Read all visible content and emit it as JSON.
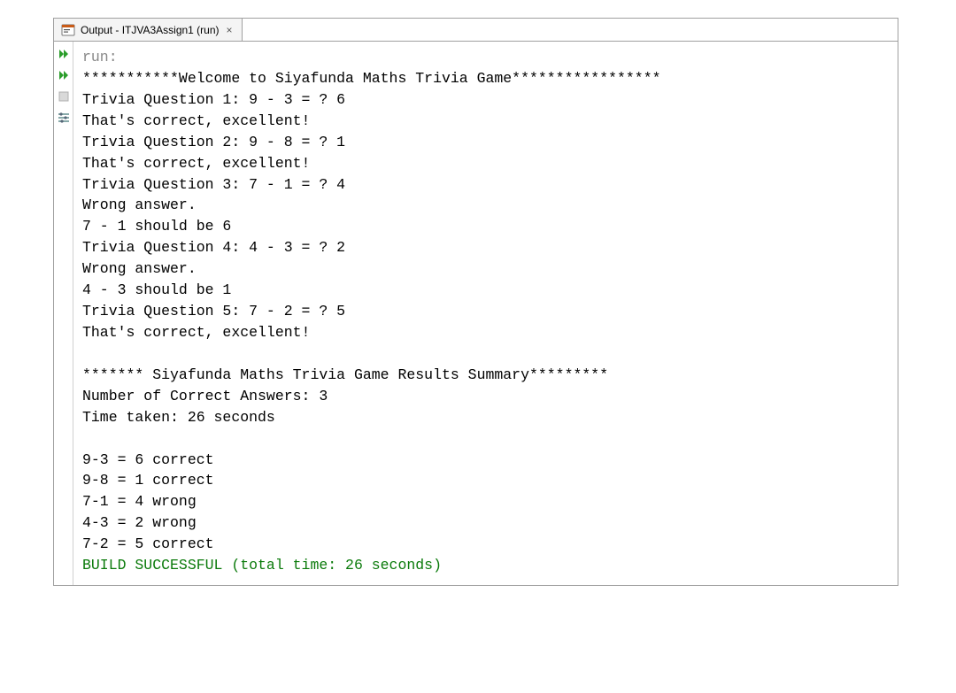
{
  "tab": {
    "title": "Output - ITJVA3Assign1 (run)"
  },
  "output": {
    "run_label": "run:",
    "welcome": "***********Welcome to Siyafunda Maths Trivia Game*****************",
    "q1": "Trivia Question 1: 9 - 3 = ? 6",
    "r1": "That's correct, excellent!",
    "q2": "Trivia Question 2: 9 - 8 = ? 1",
    "r2": "That's correct, excellent!",
    "q3": "Trivia Question 3: 7 - 1 = ? 4",
    "r3a": "Wrong answer.",
    "r3b": "7 - 1 should be 6",
    "q4": "Trivia Question 4: 4 - 3 = ? 2",
    "r4a": "Wrong answer.",
    "r4b": "4 - 3 should be 1",
    "q5": "Trivia Question 5: 7 - 2 = ? 5",
    "r5": "That's correct, excellent!",
    "blank": "",
    "summary_hdr": "******* Siyafunda Maths Trivia Game Results Summary*********",
    "sum_correct": "Number of Correct Answers: 3",
    "sum_time": "Time taken: 26 seconds",
    "s1": "9-3 = 6 correct",
    "s2": "9-8 = 1 correct",
    "s3": "7-1 = 4 wrong",
    "s4": "4-3 = 2 wrong",
    "s5": "7-2 = 5 correct",
    "build": "BUILD SUCCESSFUL (total time: 26 seconds)"
  }
}
